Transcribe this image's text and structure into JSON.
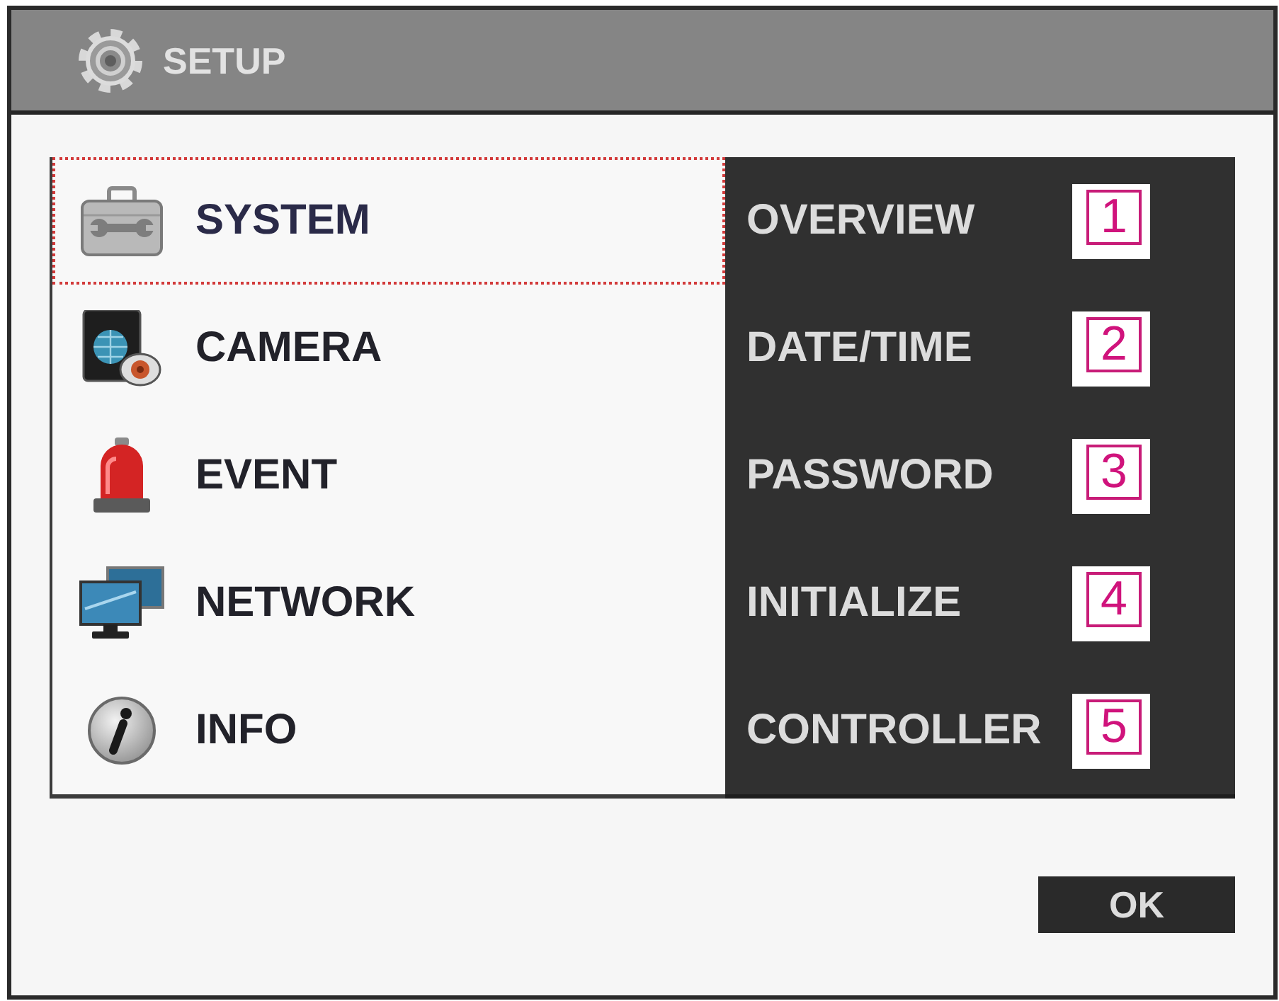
{
  "window": {
    "title": "SETUP"
  },
  "menu": [
    {
      "label": "SYSTEM",
      "selected": true
    },
    {
      "label": "CAMERA",
      "selected": false
    },
    {
      "label": "EVENT",
      "selected": false
    },
    {
      "label": "NETWORK",
      "selected": false
    },
    {
      "label": "INFO",
      "selected": false
    }
  ],
  "submenu": [
    {
      "label": "OVERVIEW",
      "callout": "1"
    },
    {
      "label": "DATE/TIME",
      "callout": "2"
    },
    {
      "label": "PASSWORD",
      "callout": "3"
    },
    {
      "label": "INITIALIZE",
      "callout": "4"
    },
    {
      "label": "CONTROLLER",
      "callout": "5"
    }
  ],
  "buttons": [
    {
      "label": "OK"
    }
  ]
}
